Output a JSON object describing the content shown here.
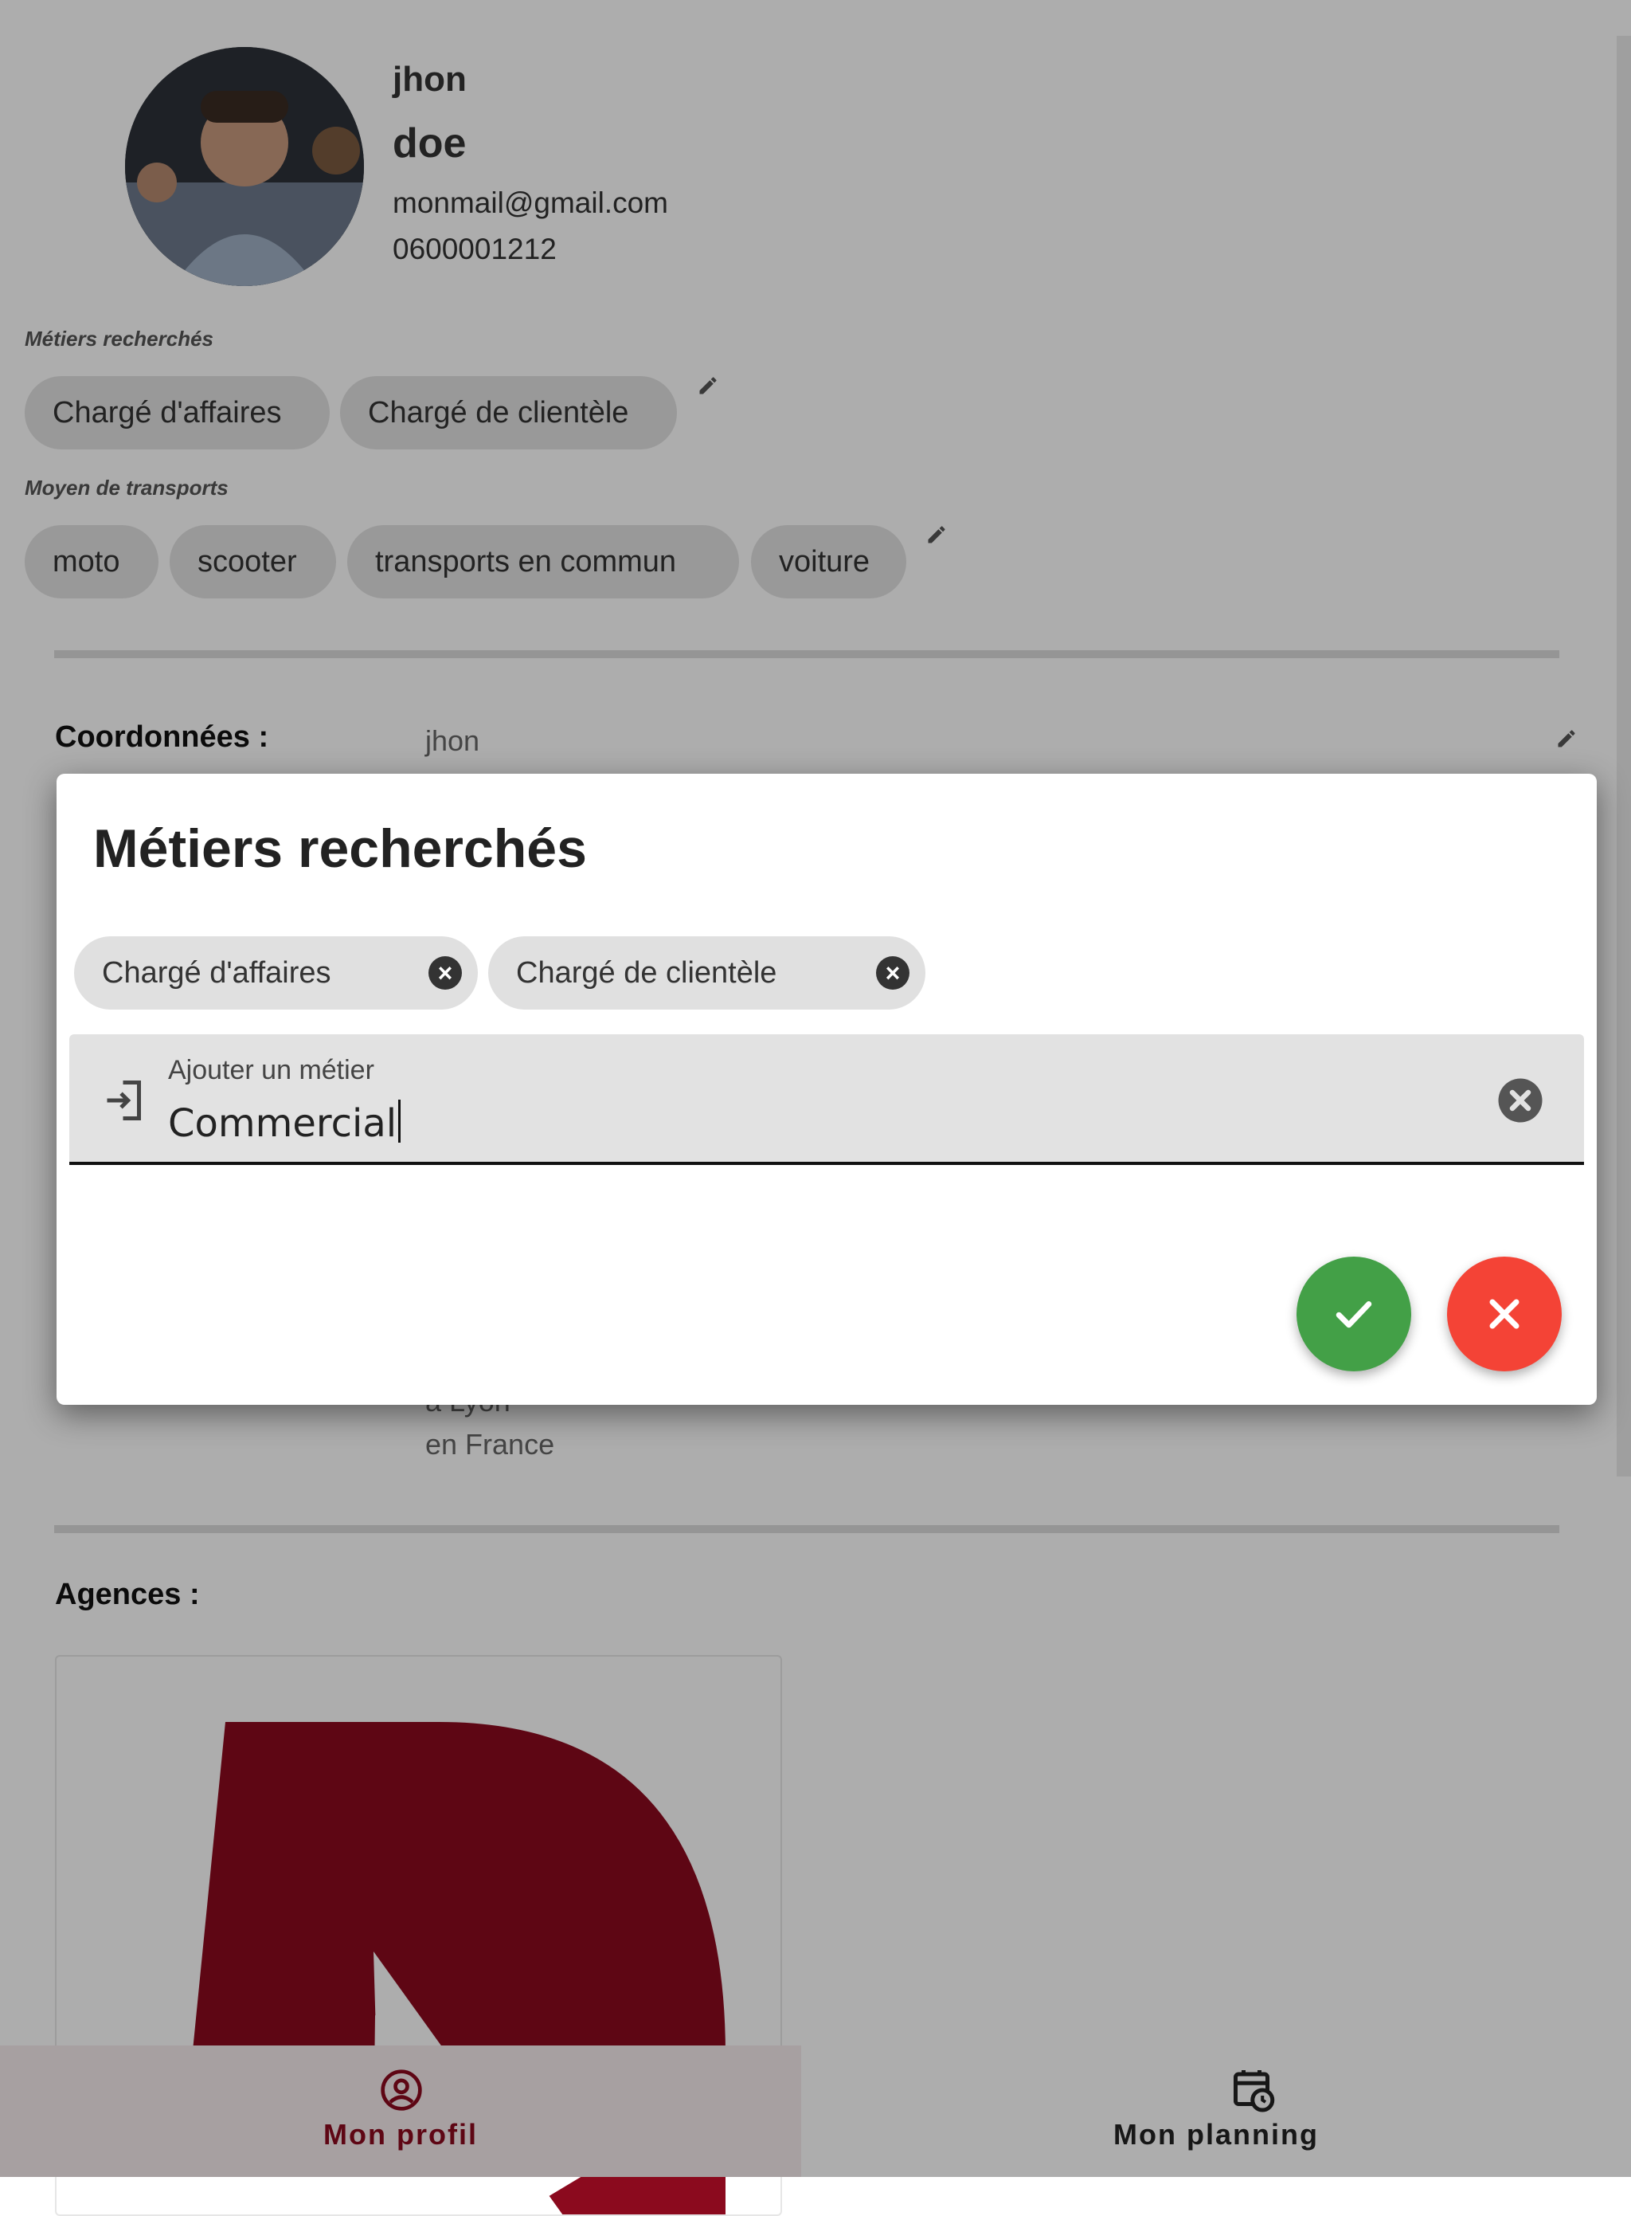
{
  "profile": {
    "first_name": "jhon",
    "last_name": "doe",
    "email": "monmail@gmail.com",
    "phone": "0600001212"
  },
  "jobs_section": {
    "label": "Métiers recherchés",
    "chips": [
      "Chargé d'affaires",
      "Chargé de clientèle"
    ]
  },
  "transport_section": {
    "label": "Moyen de transports",
    "chips": [
      "moto",
      "scooter",
      "transports en commun",
      "voiture"
    ]
  },
  "coordinates": {
    "label": "Coordonnées :",
    "first_line": "jhon",
    "hidden_line": "à Lyon",
    "last_line": "en France"
  },
  "agencies": {
    "label": "Agences :"
  },
  "bottom_nav": {
    "profile_label": "Mon profil",
    "planning_label": "Mon planning",
    "active": "profile"
  },
  "dialog": {
    "title": "Métiers recherchés",
    "chips": [
      "Chargé d'affaires",
      "Chargé de clientèle"
    ],
    "input_label": "Ajouter un métier",
    "input_value": "Commercial"
  },
  "colors": {
    "brand_red": "#8b0a1e",
    "confirm_green": "#43a047",
    "cancel_red": "#f44336"
  },
  "icons": {
    "edit": "pencil-icon",
    "chip_remove": "cancel-circle-icon",
    "input_prefix": "login-icon",
    "input_clear": "cancel-circle-icon",
    "confirm": "check-icon",
    "cancel": "close-icon",
    "nav_profile": "account-circle-icon",
    "nav_planning": "calendar-clock-icon"
  }
}
